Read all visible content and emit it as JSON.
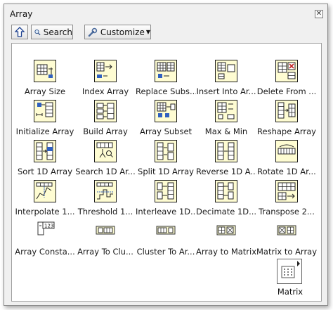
{
  "window": {
    "title": "Array"
  },
  "toolbar": {
    "up_icon": "up-arrow-icon",
    "search_label": "Search",
    "customize_label": "Customize"
  },
  "palette": {
    "items": [
      {
        "label": "Array Size",
        "icon": "array-size-icon"
      },
      {
        "label": "Index Array",
        "icon": "index-array-icon"
      },
      {
        "label": "Replace Subs...",
        "icon": "replace-subset-icon"
      },
      {
        "label": "Insert Into Ar...",
        "icon": "insert-into-array-icon"
      },
      {
        "label": "Delete From ...",
        "icon": "delete-from-array-icon"
      },
      {
        "label": "Initialize Array",
        "icon": "initialize-array-icon"
      },
      {
        "label": "Build Array",
        "icon": "build-array-icon"
      },
      {
        "label": "Array Subset",
        "icon": "array-subset-icon"
      },
      {
        "label": "Max & Min",
        "icon": "max-min-icon"
      },
      {
        "label": "Reshape Array",
        "icon": "reshape-array-icon"
      },
      {
        "label": "Sort 1D Array",
        "icon": "sort-1d-array-icon"
      },
      {
        "label": "Search 1D Ar...",
        "icon": "search-1d-array-icon"
      },
      {
        "label": "Split 1D Array",
        "icon": "split-1d-array-icon"
      },
      {
        "label": "Reverse 1D A...",
        "icon": "reverse-1d-array-icon"
      },
      {
        "label": "Rotate 1D Ar...",
        "icon": "rotate-1d-array-icon"
      },
      {
        "label": "Interpolate 1...",
        "icon": "interpolate-1d-array-icon"
      },
      {
        "label": "Threshold 1...",
        "icon": "threshold-1d-array-icon"
      },
      {
        "label": "Interleave 1D...",
        "icon": "interleave-1d-arrays-icon"
      },
      {
        "label": "Decimate 1D...",
        "icon": "decimate-1d-array-icon"
      },
      {
        "label": "Transpose 2...",
        "icon": "transpose-2d-array-icon"
      },
      {
        "label": "Array Consta...",
        "icon": "array-constant-icon"
      },
      {
        "label": "Array To Clu...",
        "icon": "array-to-cluster-icon"
      },
      {
        "label": "Cluster To Ar...",
        "icon": "cluster-to-array-icon"
      },
      {
        "label": "Array to Matrix",
        "icon": "array-to-matrix-icon"
      },
      {
        "label": "Matrix to Array",
        "icon": "matrix-to-array-icon"
      }
    ],
    "subpalette": {
      "label": "Matrix",
      "icon": "matrix-subpalette-icon"
    }
  }
}
